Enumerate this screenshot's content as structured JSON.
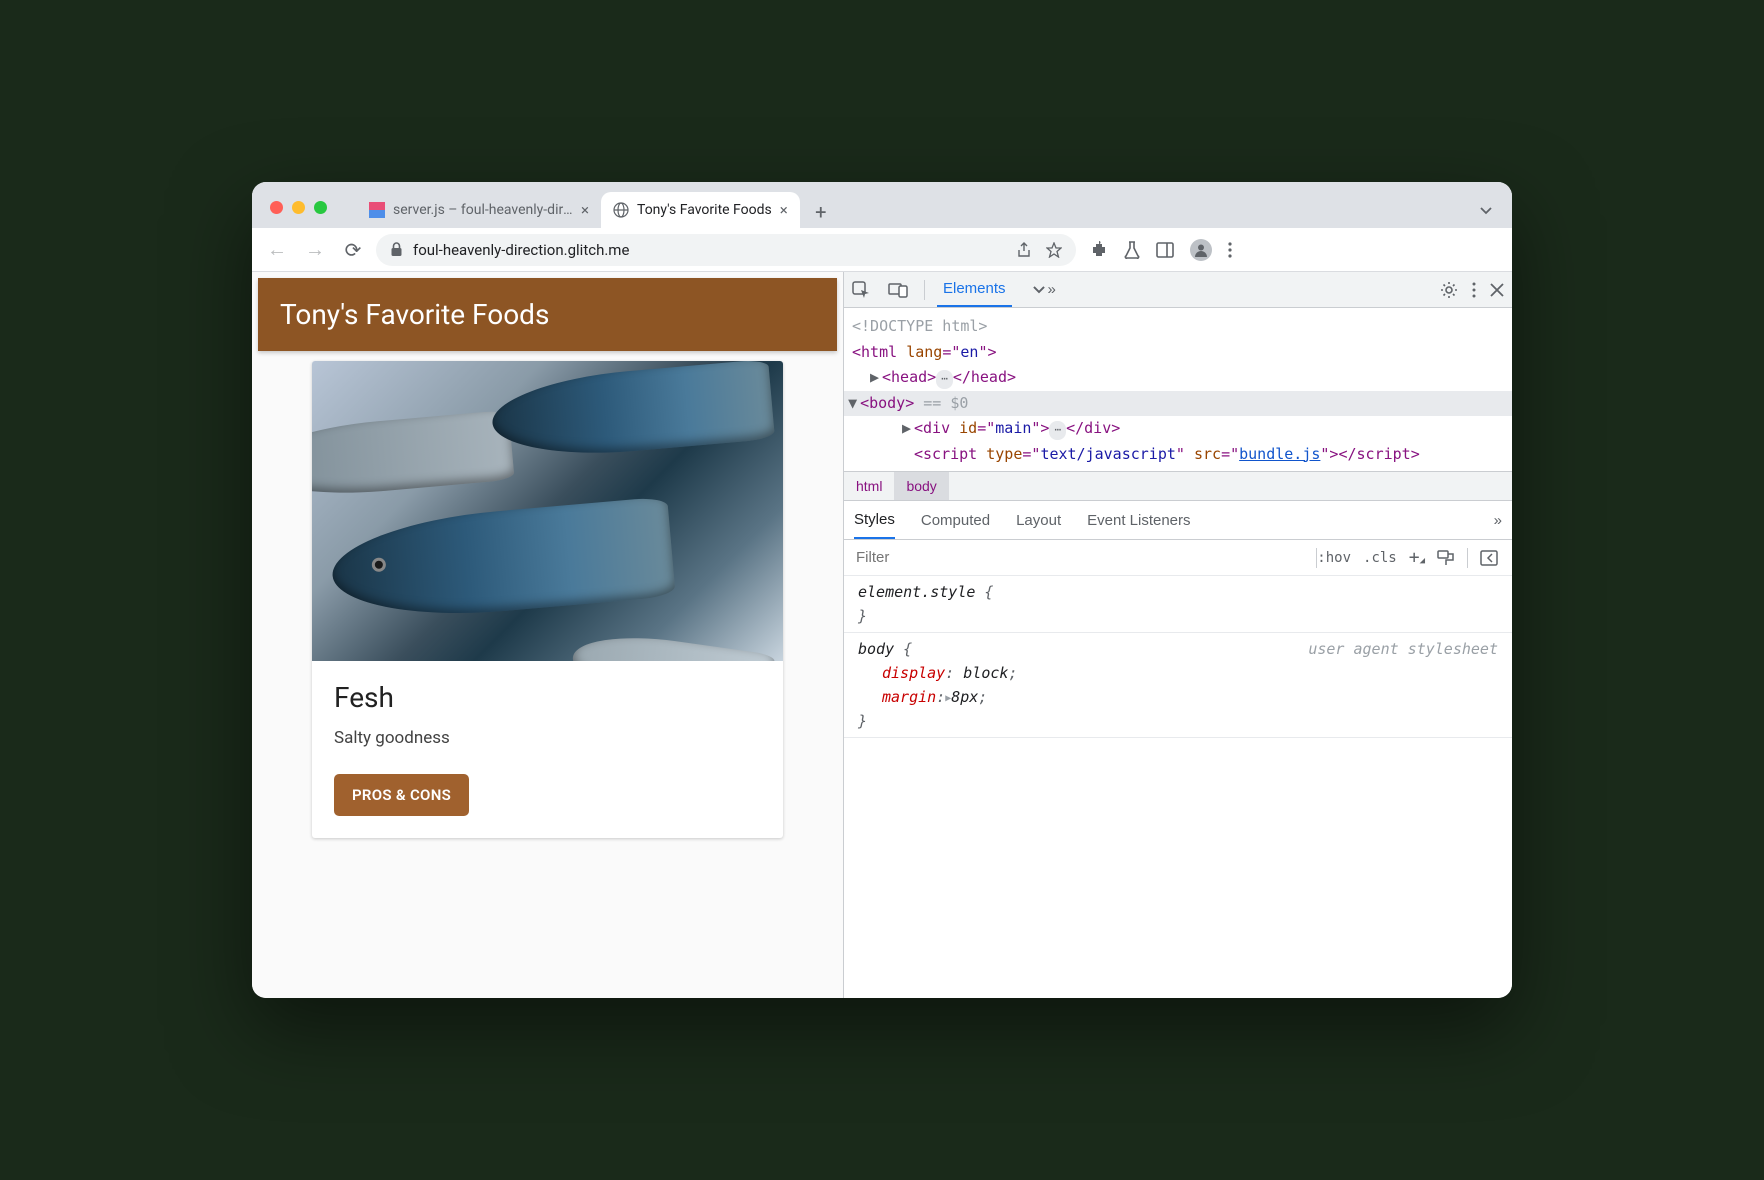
{
  "tabs": [
    {
      "title": "server.js – foul-heavenly-direct",
      "active": false
    },
    {
      "title": "Tony's Favorite Foods",
      "active": true
    }
  ],
  "url": "foul-heavenly-direction.glitch.me",
  "page": {
    "header": "Tony's Favorite Foods",
    "card": {
      "title": "Fesh",
      "desc": "Salty goodness",
      "button": "PROS & CONS"
    }
  },
  "devtools": {
    "panel_active": "Elements",
    "dom": {
      "doctype": "<!DOCTYPE html>",
      "html_open": "<html lang=\"en\">",
      "head": "<head>",
      "head_close": "</head>",
      "body": "<body>",
      "body_marker": " == $0",
      "div_main": "<div id=\"main\">",
      "div_close": "</div>",
      "script_open": "<script type=\"text/javascript\" src=\"",
      "script_src": "bundle.js",
      "script_close": "\"></script>"
    },
    "breadcrumbs": [
      "html",
      "body"
    ],
    "styles_tabs": [
      "Styles",
      "Computed",
      "Layout",
      "Event Listeners"
    ],
    "filter_placeholder": "Filter",
    "hov": ":hov",
    "cls": ".cls",
    "rules": [
      {
        "selector": "element.style",
        "props": [],
        "source": ""
      },
      {
        "selector": "body",
        "props": [
          {
            "name": "display",
            "value": "block"
          },
          {
            "name": "margin",
            "value": "8px",
            "expandable": true
          }
        ],
        "source": "user agent stylesheet"
      }
    ]
  }
}
